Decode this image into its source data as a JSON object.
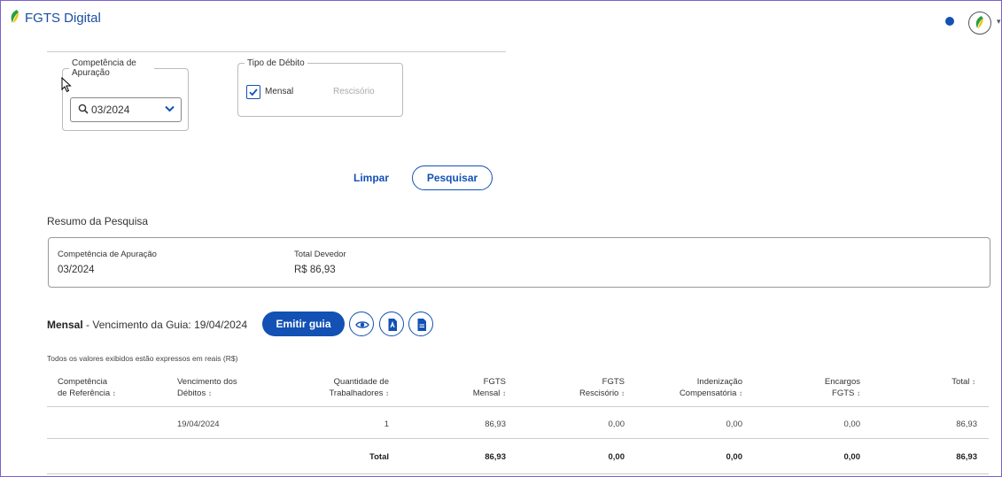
{
  "app": {
    "title": "FGTS Digital"
  },
  "filters": {
    "competencia_legend": "Competência de Apuração",
    "competencia_value": "03/2024",
    "tipo_legend": "Tipo de Débito",
    "mensal_label": "Mensal",
    "mensal_checked": true,
    "rescisorio_label": "Rescisório"
  },
  "actions": {
    "limpar": "Limpar",
    "pesquisar": "Pesquisar"
  },
  "resumo": {
    "title": "Resumo da Pesquisa",
    "competencia_label": "Competência de Apuração",
    "competencia_value": "03/2024",
    "total_label": "Total Devedor",
    "total_value": "R$ 86,93"
  },
  "guia": {
    "tipo": "Mensal",
    "vencimento_text": " - Vencimento da Guia: 19/04/2024",
    "emitir": "Emitir guia"
  },
  "note": "Todos os valores exibidos estão expressos em reais (R$)",
  "table": {
    "headers": [
      {
        "l1": "Competência",
        "l2": "de Referência"
      },
      {
        "l1": "Vencimento dos",
        "l2": "Débitos"
      },
      {
        "l1": "Quantidade de",
        "l2": "Trabalhadores"
      },
      {
        "l1": "FGTS",
        "l2": "Mensal"
      },
      {
        "l1": "FGTS",
        "l2": "Rescisório"
      },
      {
        "l1": "Indenização",
        "l2": "Compensatória"
      },
      {
        "l1": "Encargos",
        "l2": "FGTS"
      },
      {
        "l1": "",
        "l2": "Total"
      }
    ],
    "sort_icon": "↕",
    "row": [
      "",
      "19/04/2024",
      "1",
      "86,93",
      "0,00",
      "0,00",
      "0,00",
      "86,93"
    ],
    "total_row": [
      "",
      "",
      "Total",
      "86,93",
      "0,00",
      "0,00",
      "0,00",
      "86,93"
    ]
  },
  "icons": {
    "logo": "fgts-leaf-icon",
    "search": "search-icon",
    "chevron": "chevron-down-icon",
    "check": "check-icon",
    "eye": "eye-icon",
    "pdf": "pdf-file-icon",
    "doc": "document-icon"
  },
  "colors": {
    "primary": "#1351b4",
    "brand_green": "#2e9e3e",
    "brand_yellow": "#f2c400"
  }
}
